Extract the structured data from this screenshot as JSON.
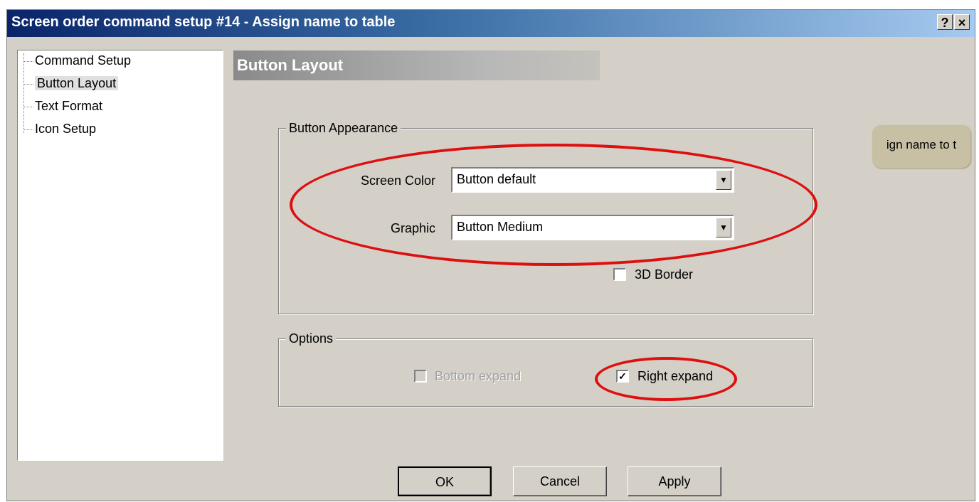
{
  "window": {
    "title": "Screen order command setup #14 - Assign name to table",
    "help_glyph": "?",
    "close_glyph": "×"
  },
  "tree": {
    "items": [
      {
        "label": "Command Setup",
        "selected": false
      },
      {
        "label": "Button Layout",
        "selected": true
      },
      {
        "label": "Text Format",
        "selected": false
      },
      {
        "label": "Icon Setup",
        "selected": false
      }
    ]
  },
  "panel": {
    "header": "Button Layout",
    "appearance": {
      "label": "Button Appearance",
      "screen_color_label": "Screen Color",
      "screen_color_value": "Button default",
      "graphic_label": "Graphic",
      "graphic_value": "Button Medium",
      "border_3d_label": "3D Border",
      "border_3d_checked": false
    },
    "options": {
      "label": "Options",
      "bottom_expand_label": "Bottom expand",
      "bottom_expand_checked": false,
      "bottom_expand_enabled": false,
      "right_expand_label": "Right expand",
      "right_expand_checked": true
    }
  },
  "preview": {
    "text": "ign name to t",
    "color": "#c8c0a4"
  },
  "buttons": {
    "ok": "OK",
    "cancel": "Cancel",
    "apply": "Apply"
  },
  "icons": {
    "dropdown_arrow": "▼",
    "checkmark": "✓"
  },
  "colors": {
    "annotation": "#dd0f0f",
    "titlebar_start": "#0a246a",
    "dialog_bg": "#d4d0c8"
  }
}
